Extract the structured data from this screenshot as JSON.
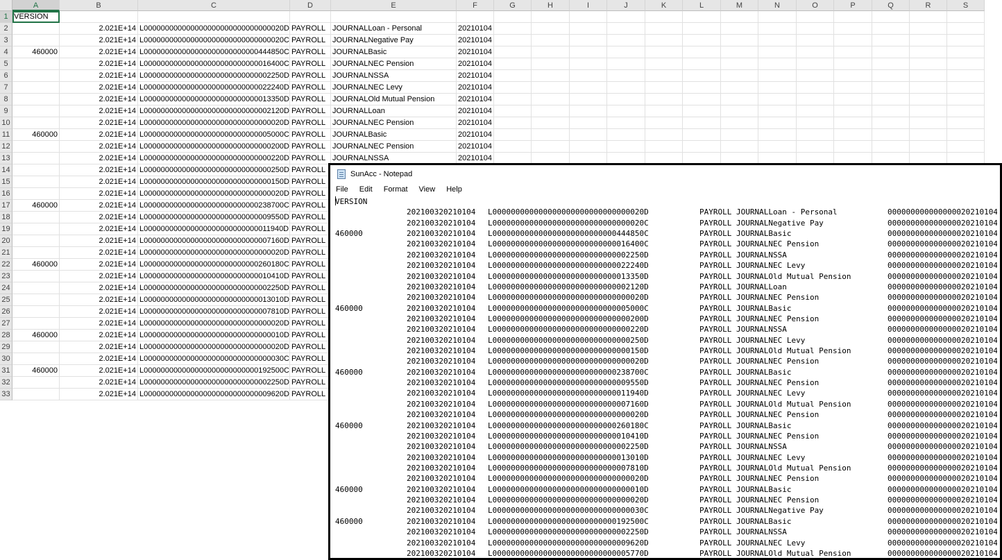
{
  "columns": [
    "A",
    "B",
    "C",
    "D",
    "E",
    "F",
    "G",
    "H",
    "I",
    "J",
    "K",
    "L",
    "M",
    "N",
    "O",
    "P",
    "Q",
    "R",
    "S"
  ],
  "rows": [
    {
      "n": "1",
      "a": "VERSION",
      "b": "",
      "c": "",
      "d": "",
      "e": "",
      "f": ""
    },
    {
      "n": "2",
      "a": "",
      "b": "2.021E+14",
      "c": "L000000000000000000000000000000020D",
      "d": "PAYROLL",
      "e": "JOURNALLoan - Personal",
      "f": "20210104"
    },
    {
      "n": "3",
      "a": "",
      "b": "2.021E+14",
      "c": "L000000000000000000000000000000020C",
      "d": "PAYROLL",
      "e": "JOURNALNegative Pay",
      "f": "20210104"
    },
    {
      "n": "4",
      "a": "460000",
      "b": "2.021E+14",
      "c": "L000000000000000000000000000444850C",
      "d": "PAYROLL",
      "e": "JOURNALBasic",
      "f": "20210104"
    },
    {
      "n": "5",
      "a": "",
      "b": "2.021E+14",
      "c": "L000000000000000000000000000016400C",
      "d": "PAYROLL",
      "e": "JOURNALNEC Pension",
      "f": "20210104"
    },
    {
      "n": "6",
      "a": "",
      "b": "2.021E+14",
      "c": "L000000000000000000000000000002250D",
      "d": "PAYROLL",
      "e": "JOURNALNSSA",
      "f": "20210104"
    },
    {
      "n": "7",
      "a": "",
      "b": "2.021E+14",
      "c": "L000000000000000000000000000022240D",
      "d": "PAYROLL",
      "e": "JOURNALNEC Levy",
      "f": "20210104"
    },
    {
      "n": "8",
      "a": "",
      "b": "2.021E+14",
      "c": "L000000000000000000000000000013350D",
      "d": "PAYROLL",
      "e": "JOURNALOld Mutual Pension",
      "f": "20210104"
    },
    {
      "n": "9",
      "a": "",
      "b": "2.021E+14",
      "c": "L000000000000000000000000000002120D",
      "d": "PAYROLL",
      "e": "JOURNALLoan",
      "f": "20210104"
    },
    {
      "n": "10",
      "a": "",
      "b": "2.021E+14",
      "c": "L000000000000000000000000000000020D",
      "d": "PAYROLL",
      "e": "JOURNALNEC Pension",
      "f": "20210104"
    },
    {
      "n": "11",
      "a": "460000",
      "b": "2.021E+14",
      "c": "L000000000000000000000000000005000C",
      "d": "PAYROLL",
      "e": "JOURNALBasic",
      "f": "20210104"
    },
    {
      "n": "12",
      "a": "",
      "b": "2.021E+14",
      "c": "L000000000000000000000000000000200D",
      "d": "PAYROLL",
      "e": "JOURNALNEC Pension",
      "f": "20210104"
    },
    {
      "n": "13",
      "a": "",
      "b": "2.021E+14",
      "c": "L000000000000000000000000000000220D",
      "d": "PAYROLL",
      "e": "JOURNALNSSA",
      "f": "20210104"
    },
    {
      "n": "14",
      "a": "",
      "b": "2.021E+14",
      "c": "L000000000000000000000000000000250D",
      "d": "PAYROLL",
      "e": "",
      "f": ""
    },
    {
      "n": "15",
      "a": "",
      "b": "2.021E+14",
      "c": "L000000000000000000000000000000150D",
      "d": "PAYROLL",
      "e": "",
      "f": ""
    },
    {
      "n": "16",
      "a": "",
      "b": "2.021E+14",
      "c": "L000000000000000000000000000000020D",
      "d": "PAYROLL",
      "e": "",
      "f": ""
    },
    {
      "n": "17",
      "a": "460000",
      "b": "2.021E+14",
      "c": "L000000000000000000000000000238700C",
      "d": "PAYROLL",
      "e": "",
      "f": ""
    },
    {
      "n": "18",
      "a": "",
      "b": "2.021E+14",
      "c": "L000000000000000000000000000009550D",
      "d": "PAYROLL",
      "e": "",
      "f": ""
    },
    {
      "n": "19",
      "a": "",
      "b": "2.021E+14",
      "c": "L000000000000000000000000000011940D",
      "d": "PAYROLL",
      "e": "",
      "f": ""
    },
    {
      "n": "20",
      "a": "",
      "b": "2.021E+14",
      "c": "L000000000000000000000000000007160D",
      "d": "PAYROLL",
      "e": "",
      "f": ""
    },
    {
      "n": "21",
      "a": "",
      "b": "2.021E+14",
      "c": "L000000000000000000000000000000020D",
      "d": "PAYROLL",
      "e": "",
      "f": ""
    },
    {
      "n": "22",
      "a": "460000",
      "b": "2.021E+14",
      "c": "L000000000000000000000000000260180C",
      "d": "PAYROLL",
      "e": "",
      "f": ""
    },
    {
      "n": "23",
      "a": "",
      "b": "2.021E+14",
      "c": "L000000000000000000000000000010410D",
      "d": "PAYROLL",
      "e": "",
      "f": ""
    },
    {
      "n": "24",
      "a": "",
      "b": "2.021E+14",
      "c": "L000000000000000000000000000002250D",
      "d": "PAYROLL",
      "e": "",
      "f": ""
    },
    {
      "n": "25",
      "a": "",
      "b": "2.021E+14",
      "c": "L000000000000000000000000000013010D",
      "d": "PAYROLL",
      "e": "",
      "f": ""
    },
    {
      "n": "26",
      "a": "",
      "b": "2.021E+14",
      "c": "L000000000000000000000000000007810D",
      "d": "PAYROLL",
      "e": "",
      "f": ""
    },
    {
      "n": "27",
      "a": "",
      "b": "2.021E+14",
      "c": "L000000000000000000000000000000020D",
      "d": "PAYROLL",
      "e": "",
      "f": ""
    },
    {
      "n": "28",
      "a": "460000",
      "b": "2.021E+14",
      "c": "L000000000000000000000000000000010D",
      "d": "PAYROLL",
      "e": "",
      "f": ""
    },
    {
      "n": "29",
      "a": "",
      "b": "2.021E+14",
      "c": "L000000000000000000000000000000020D",
      "d": "PAYROLL",
      "e": "",
      "f": ""
    },
    {
      "n": "30",
      "a": "",
      "b": "2.021E+14",
      "c": "L000000000000000000000000000000030C",
      "d": "PAYROLL",
      "e": "",
      "f": ""
    },
    {
      "n": "31",
      "a": "460000",
      "b": "2.021E+14",
      "c": "L000000000000000000000000000192500C",
      "d": "PAYROLL",
      "e": "",
      "f": ""
    },
    {
      "n": "32",
      "a": "",
      "b": "2.021E+14",
      "c": "L000000000000000000000000000002250D",
      "d": "PAYROLL",
      "e": "",
      "f": ""
    },
    {
      "n": "33",
      "a": "",
      "b": "2.021E+14",
      "c": "L000000000000000000000000000009620D",
      "d": "PAYROLL",
      "e": "",
      "f": ""
    }
  ],
  "notepad": {
    "title": "SunAcc - Notepad",
    "icon": "notepad-icon",
    "menu": [
      "File",
      "Edit",
      "Format",
      "View",
      "Help"
    ],
    "first_line": "VERSION",
    "lines": [
      {
        "a": "",
        "b": "202100320210104",
        "c": "L000000000000000000000000000000020D",
        "d": "PAYROLL JOURNALLoan - Personal",
        "e": "000000000000000020210104"
      },
      {
        "a": "",
        "b": "202100320210104",
        "c": "L000000000000000000000000000000020C",
        "d": "PAYROLL JOURNALNegative Pay",
        "e": "000000000000000020210104"
      },
      {
        "a": "460000",
        "b": "202100320210104",
        "c": "L000000000000000000000000000444850C",
        "d": "PAYROLL JOURNALBasic",
        "e": "000000000000000020210104"
      },
      {
        "a": "",
        "b": "202100320210104",
        "c": "L000000000000000000000000000016400C",
        "d": "PAYROLL JOURNALNEC Pension",
        "e": "000000000000000020210104"
      },
      {
        "a": "",
        "b": "202100320210104",
        "c": "L000000000000000000000000000002250D",
        "d": "PAYROLL JOURNALNSSA",
        "e": "000000000000000020210104"
      },
      {
        "a": "",
        "b": "202100320210104",
        "c": "L000000000000000000000000000022240D",
        "d": "PAYROLL JOURNALNEC Levy",
        "e": "000000000000000020210104"
      },
      {
        "a": "",
        "b": "202100320210104",
        "c": "L000000000000000000000000000013350D",
        "d": "PAYROLL JOURNALOld Mutual Pension",
        "e": "000000000000000020210104"
      },
      {
        "a": "",
        "b": "202100320210104",
        "c": "L000000000000000000000000000002120D",
        "d": "PAYROLL JOURNALLoan",
        "e": "000000000000000020210104"
      },
      {
        "a": "",
        "b": "202100320210104",
        "c": "L000000000000000000000000000000020D",
        "d": "PAYROLL JOURNALNEC Pension",
        "e": "000000000000000020210104"
      },
      {
        "a": "460000",
        "b": "202100320210104",
        "c": "L000000000000000000000000000005000C",
        "d": "PAYROLL JOURNALBasic",
        "e": "000000000000000020210104"
      },
      {
        "a": "",
        "b": "202100320210104",
        "c": "L000000000000000000000000000000200D",
        "d": "PAYROLL JOURNALNEC Pension",
        "e": "000000000000000020210104"
      },
      {
        "a": "",
        "b": "202100320210104",
        "c": "L000000000000000000000000000000220D",
        "d": "PAYROLL JOURNALNSSA",
        "e": "000000000000000020210104"
      },
      {
        "a": "",
        "b": "202100320210104",
        "c": "L000000000000000000000000000000250D",
        "d": "PAYROLL JOURNALNEC Levy",
        "e": "000000000000000020210104"
      },
      {
        "a": "",
        "b": "202100320210104",
        "c": "L000000000000000000000000000000150D",
        "d": "PAYROLL JOURNALOld Mutual Pension",
        "e": "000000000000000020210104"
      },
      {
        "a": "",
        "b": "202100320210104",
        "c": "L000000000000000000000000000000020D",
        "d": "PAYROLL JOURNALNEC Pension",
        "e": "000000000000000020210104"
      },
      {
        "a": "460000",
        "b": "202100320210104",
        "c": "L000000000000000000000000000238700C",
        "d": "PAYROLL JOURNALBasic",
        "e": "000000000000000020210104"
      },
      {
        "a": "",
        "b": "202100320210104",
        "c": "L000000000000000000000000000009550D",
        "d": "PAYROLL JOURNALNEC Pension",
        "e": "000000000000000020210104"
      },
      {
        "a": "",
        "b": "202100320210104",
        "c": "L000000000000000000000000000011940D",
        "d": "PAYROLL JOURNALNEC Levy",
        "e": "000000000000000020210104"
      },
      {
        "a": "",
        "b": "202100320210104",
        "c": "L000000000000000000000000000007160D",
        "d": "PAYROLL JOURNALOld Mutual Pension",
        "e": "000000000000000020210104"
      },
      {
        "a": "",
        "b": "202100320210104",
        "c": "L000000000000000000000000000000020D",
        "d": "PAYROLL JOURNALNEC Pension",
        "e": "000000000000000020210104"
      },
      {
        "a": "460000",
        "b": "202100320210104",
        "c": "L000000000000000000000000000260180C",
        "d": "PAYROLL JOURNALBasic",
        "e": "000000000000000020210104"
      },
      {
        "a": "",
        "b": "202100320210104",
        "c": "L000000000000000000000000000010410D",
        "d": "PAYROLL JOURNALNEC Pension",
        "e": "000000000000000020210104"
      },
      {
        "a": "",
        "b": "202100320210104",
        "c": "L000000000000000000000000000002250D",
        "d": "PAYROLL JOURNALNSSA",
        "e": "000000000000000020210104"
      },
      {
        "a": "",
        "b": "202100320210104",
        "c": "L000000000000000000000000000013010D",
        "d": "PAYROLL JOURNALNEC Levy",
        "e": "000000000000000020210104"
      },
      {
        "a": "",
        "b": "202100320210104",
        "c": "L000000000000000000000000000007810D",
        "d": "PAYROLL JOURNALOld Mutual Pension",
        "e": "000000000000000020210104"
      },
      {
        "a": "",
        "b": "202100320210104",
        "c": "L000000000000000000000000000000020D",
        "d": "PAYROLL JOURNALNEC Pension",
        "e": "000000000000000020210104"
      },
      {
        "a": "460000",
        "b": "202100320210104",
        "c": "L000000000000000000000000000000010D",
        "d": "PAYROLL JOURNALBasic",
        "e": "000000000000000020210104"
      },
      {
        "a": "",
        "b": "202100320210104",
        "c": "L000000000000000000000000000000020D",
        "d": "PAYROLL JOURNALNEC Pension",
        "e": "000000000000000020210104"
      },
      {
        "a": "",
        "b": "202100320210104",
        "c": "L000000000000000000000000000000030C",
        "d": "PAYROLL JOURNALNegative Pay",
        "e": "000000000000000020210104"
      },
      {
        "a": "460000",
        "b": "202100320210104",
        "c": "L000000000000000000000000000192500C",
        "d": "PAYROLL JOURNALBasic",
        "e": "000000000000000020210104"
      },
      {
        "a": "",
        "b": "202100320210104",
        "c": "L000000000000000000000000000002250D",
        "d": "PAYROLL JOURNALNSSA",
        "e": "000000000000000020210104"
      },
      {
        "a": "",
        "b": "202100320210104",
        "c": "L000000000000000000000000000009620D",
        "d": "PAYROLL JOURNALNEC Levy",
        "e": "000000000000000020210104"
      },
      {
        "a": "",
        "b": "202100320210104",
        "c": "L000000000000000000000000000005770D",
        "d": "PAYROLL JOURNALOld Mutual Pension",
        "e": "000000000000000020210104"
      }
    ]
  }
}
